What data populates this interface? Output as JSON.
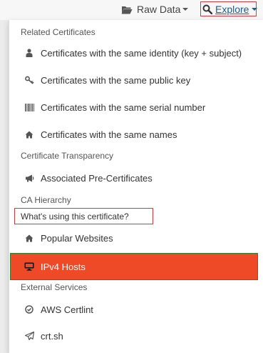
{
  "topbar": {
    "raw_data_label": "Raw Data",
    "explore_label": "Explore",
    "icons": [
      "folder-open-icon",
      "search-icon"
    ]
  },
  "dropdown": {
    "sections": [
      {
        "header": "Related Certificates",
        "items": [
          {
            "label": "Certificates with the same identity (key + subject)",
            "icon": "user-icon"
          },
          {
            "label": "Certificates with the same public key",
            "icon": "key-icon"
          },
          {
            "label": "Certificates with the same serial number",
            "icon": "barcode-icon"
          },
          {
            "label": "Certificates with the same names",
            "icon": "home-icon"
          }
        ]
      },
      {
        "header": "Certificate Transparency",
        "items": [
          {
            "label": "Associated Pre-Certificates",
            "icon": "bullhorn-icon"
          }
        ]
      },
      {
        "header": "CA Hierarchy",
        "items": []
      },
      {
        "header": "What's using this certificate?",
        "items": [
          {
            "label": "Popular Websites",
            "icon": "home-icon"
          },
          {
            "label": "IPv4 Hosts",
            "icon": "desktop-icon",
            "highlighted": true
          }
        ]
      },
      {
        "header": "External Services",
        "items": [
          {
            "label": "AWS Certlint",
            "icon": "check-circle-icon"
          },
          {
            "label": "crt.sh",
            "icon": "paper-plane-icon"
          }
        ]
      }
    ]
  },
  "colors": {
    "highlight": "#ee4a28",
    "highlight_border": "#2e7d32",
    "annotation_box": "#d9363e",
    "link": "#1a5f8e"
  }
}
